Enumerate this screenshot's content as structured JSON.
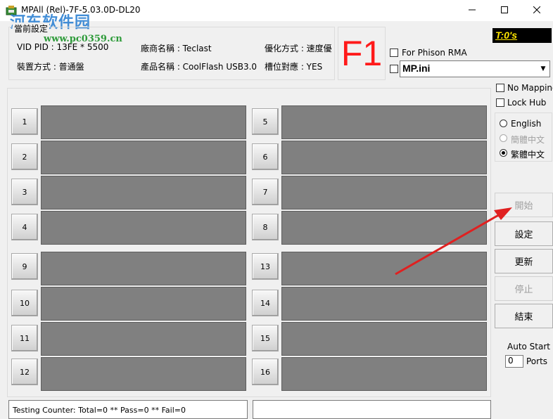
{
  "window": {
    "title": "MPAll (Rel)-7F-5.03.0D-DL20",
    "watermark": "河东软件园",
    "watermark_url": "www.pc0359.cn"
  },
  "settings": {
    "legend": "當前設定",
    "vid_pid": "VID PID : 13FE * 5500",
    "vendor": "廠商名稱 : Teclast",
    "optimize": "優化方式 : 速度優",
    "device_mode": "裝置方式 : 普通盤",
    "product": "產品名稱 : CoolFlash USB3.0",
    "slot_map": "槽位對應 : YES"
  },
  "f1_label": "F1",
  "for_phison_rma": "For Phison RMA",
  "ini_file": "MP.ini",
  "timer": "T:0's",
  "options": {
    "no_mapping": "No Mapping",
    "lock_hub": "Lock Hub",
    "languages": [
      "English",
      "簡體中文",
      "繁體中文"
    ],
    "selected_language": "繁體中文"
  },
  "ports_left": [
    "1",
    "2",
    "3",
    "4",
    "9",
    "10",
    "11",
    "12"
  ],
  "ports_right": [
    "5",
    "6",
    "7",
    "8",
    "13",
    "14",
    "15",
    "16"
  ],
  "buttons": {
    "start": "開始",
    "settings": "設定",
    "update": "更新",
    "stop": "停止",
    "end": "結束"
  },
  "auto_start": {
    "label": "Auto Start",
    "value": "0",
    "unit": "Ports"
  },
  "status": {
    "counter": "Testing Counter: Total=0 ** Pass=0 ** Fail=0"
  },
  "colors": {
    "port_bar": "#808080",
    "f1": "#ff1a1a",
    "timer_text": "#ffe600",
    "arrow": "#e02020"
  }
}
